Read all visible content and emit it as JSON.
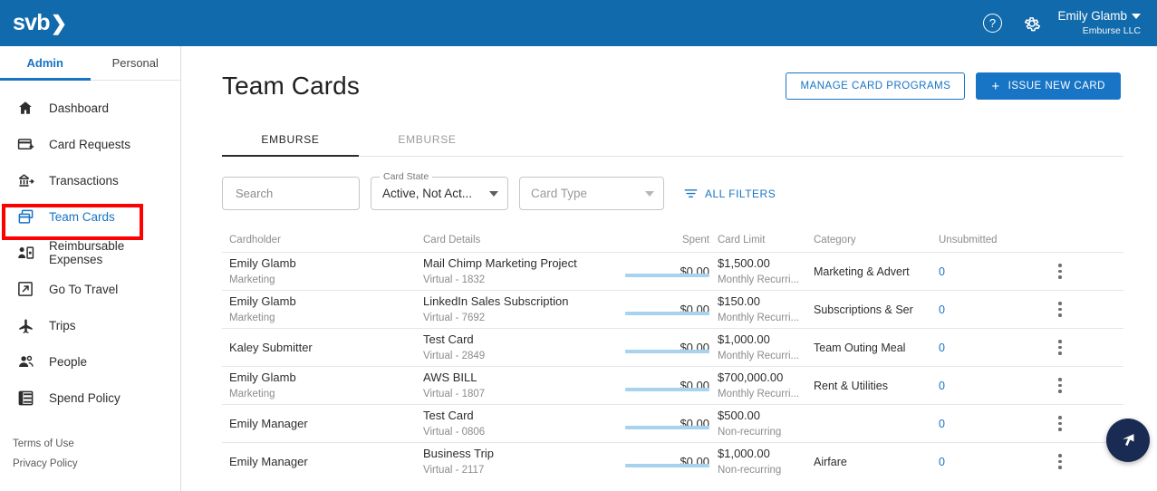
{
  "topbar": {
    "logo_text": "svb",
    "logo_chevron": "❯",
    "help_glyph": "?",
    "user_name": "Emily Glamb",
    "user_org": "Emburse LLC"
  },
  "sidebar": {
    "segments": [
      {
        "label": "Admin",
        "active": true
      },
      {
        "label": "Personal",
        "active": false
      }
    ],
    "items": [
      {
        "label": "Dashboard",
        "icon": "home-icon"
      },
      {
        "label": "Card Requests",
        "icon": "card-plus-icon"
      },
      {
        "label": "Transactions",
        "icon": "transactions-icon"
      },
      {
        "label": "Team Cards",
        "icon": "team-cards-icon"
      },
      {
        "label": "Reimbursable Expenses",
        "icon": "reimbursable-icon"
      },
      {
        "label": "Go To Travel",
        "icon": "external-link-icon"
      },
      {
        "label": "Trips",
        "icon": "airplane-icon"
      },
      {
        "label": "People",
        "icon": "people-icon"
      },
      {
        "label": "Spend Policy",
        "icon": "spend-policy-icon"
      }
    ],
    "footer": {
      "terms": "Terms of Use",
      "privacy": "Privacy Policy"
    }
  },
  "main": {
    "page_title": "Team Cards",
    "manage_button": "MANAGE CARD PROGRAMS",
    "issue_button": "ISSUE NEW CARD",
    "issue_button_plus": "+",
    "tabs": [
      {
        "label": "EMBURSE",
        "active": true
      },
      {
        "label": "EMBURSE",
        "active": false
      }
    ],
    "filters": {
      "search_placeholder": "Search",
      "search_value": "",
      "card_state_label": "Card State",
      "card_state_value": "Active, Not Act...",
      "card_type_placeholder": "Card Type",
      "all_filters_label": "ALL FILTERS"
    },
    "table": {
      "headers": {
        "cardholder": "Cardholder",
        "card_details": "Card Details",
        "spent": "Spent",
        "card_limit": "Card Limit",
        "category": "Category",
        "unsubmitted": "Unsubmitted"
      },
      "rows": [
        {
          "cardholder": "Emily Glamb",
          "department": "Marketing",
          "card_name": "Mail Chimp Marketing Project",
          "card_sub": "Virtual - 1832",
          "spent": "$0.00",
          "limit": "$1,500.00",
          "limit_sub": "Monthly Recurri...",
          "category": "Marketing & Advert",
          "unsubmitted": "0"
        },
        {
          "cardholder": "Emily Glamb",
          "department": "Marketing",
          "card_name": "LinkedIn Sales Subscription",
          "card_sub": "Virtual - 7692",
          "spent": "$0.00",
          "limit": "$150.00",
          "limit_sub": "Monthly Recurri...",
          "category": "Subscriptions & Ser",
          "unsubmitted": "0"
        },
        {
          "cardholder": "Kaley Submitter",
          "department": "",
          "card_name": "Test Card",
          "card_sub": "Virtual - 2849",
          "spent": "$0.00",
          "limit": "$1,000.00",
          "limit_sub": "Monthly Recurri...",
          "category": "Team Outing Meal",
          "unsubmitted": "0"
        },
        {
          "cardholder": "Emily Glamb",
          "department": "Marketing",
          "card_name": "AWS BILL",
          "card_sub": "Virtual - 1807",
          "spent": "$0.00",
          "limit": "$700,000.00",
          "limit_sub": "Monthly Recurri...",
          "category": "Rent & Utilities",
          "unsubmitted": "0"
        },
        {
          "cardholder": "Emily Manager",
          "department": "",
          "card_name": "Test Card",
          "card_sub": "Virtual - 0806",
          "spent": "$0.00",
          "limit": "$500.00",
          "limit_sub": "Non-recurring",
          "category": "",
          "unsubmitted": "0"
        },
        {
          "cardholder": "Emily Manager",
          "department": "",
          "card_name": "Business Trip",
          "card_sub": "Virtual - 2117",
          "spent": "$0.00",
          "limit": "$1,000.00",
          "limit_sub": "Non-recurring",
          "category": "Airfare",
          "unsubmitted": "0"
        }
      ]
    }
  },
  "colors": {
    "brand_blue": "#116aab",
    "link_blue": "#1874c4",
    "highlight_red": "#ff0000",
    "progress_blue": "#a7d3ee",
    "fab_navy": "#1a2b53"
  }
}
